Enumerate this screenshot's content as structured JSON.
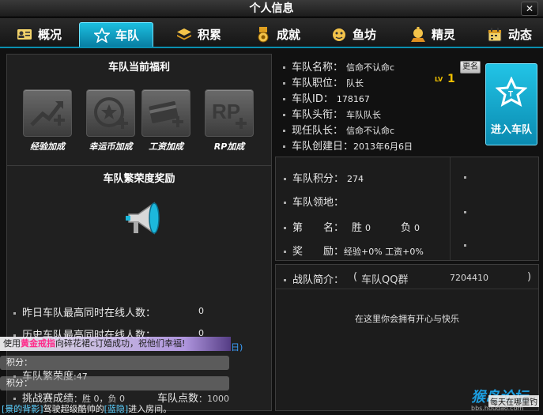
{
  "window": {
    "title": "个人信息",
    "close": "✕"
  },
  "tabs": [
    {
      "label": "概况",
      "icon": "id-card-icon"
    },
    {
      "label": "车队",
      "icon": "star-icon"
    },
    {
      "label": "积累",
      "icon": "stack-icon"
    },
    {
      "label": "成就",
      "icon": "medal-icon"
    },
    {
      "label": "鱼坊",
      "icon": "fish-icon"
    },
    {
      "label": "精灵",
      "icon": "genie-icon"
    },
    {
      "label": "动态",
      "icon": "calendar-icon"
    }
  ],
  "active_tab": "车队",
  "benefits": {
    "title": "车队当前福利",
    "items": [
      {
        "label": "经验加成",
        "icon": "exp-up-icon"
      },
      {
        "label": "幸运币加成",
        "icon": "coin-plus-icon"
      },
      {
        "label": "工资加成",
        "icon": "card-plus-icon"
      },
      {
        "label": "RP加成",
        "icon": "rp-plus-icon"
      }
    ]
  },
  "prosperity": {
    "title": "车队繁荣度奖励",
    "yesterday_label": "昨日车队最高同时在线人数：",
    "yesterday_value": "0",
    "history_label": "历史车队最高同时在线人数：",
    "history_value": "0",
    "prosperity_label": "车队繁荣度",
    "prosperity_value": ":47",
    "challenge_label": "挑战赛成绩",
    "challenge_value": "：胜 0，负 0",
    "points_label": "车队点数",
    "points_value": "：1000"
  },
  "team_info": {
    "name_label": "车队名称：",
    "name_value": "信命不认命c",
    "rename_button": "更名",
    "position_label": "车队职位：",
    "position_value": "队长",
    "lv_label": "LV",
    "lv_value": "1",
    "id_label": "车队ID：",
    "id_value": "178167",
    "title_label": "车队头衔：",
    "title_value": "车队队长",
    "leader_label": "现任队长：",
    "leader_value": "信命不认命c",
    "created_label": "车队创建日：",
    "created_value": "2013年6月6日",
    "join_button": "进入车队"
  },
  "team_stats": {
    "points_label": "车队积分：",
    "points_value": "274",
    "territory_label": "车队领地：",
    "rank_label": "第　　名：",
    "win_label": "胜",
    "win_value": "0",
    "lose_label": "负",
    "lose_value": "0",
    "reward_label": "奖　　励：",
    "reward_value": "经验+0%  工资+0%"
  },
  "intro": {
    "label": "战队简介：",
    "open_paren": "(",
    "qq_label": "车队QQ群",
    "qq_value": "7204410",
    "close_paren": ")",
    "text": "在这里你会拥有开心与快乐"
  },
  "chat": {
    "line1_prefix": "使用",
    "line1_item": "黄金戒指",
    "line1_suffix": "向碎花裙c订婚成功，祝他们幸福!",
    "line1_tail": "日)",
    "line2": "积分：",
    "line3": "积分：",
    "line4_prefix": "[景的背影]",
    "line4_middle": "驾驶超级酷帅的",
    "line4_tag": "[蓝隐]",
    "line4_suffix": "进入房间。",
    "badge_text": "每天在哪里钓"
  },
  "watermark": {
    "text": "猴岛论坛",
    "url": "bbs.houdao.com"
  },
  "colors": {
    "accent": "#1cb8dc",
    "gold": "#f0c000",
    "chat_pink": "#ff4da6",
    "chat_blue": "#3aa0ff"
  }
}
